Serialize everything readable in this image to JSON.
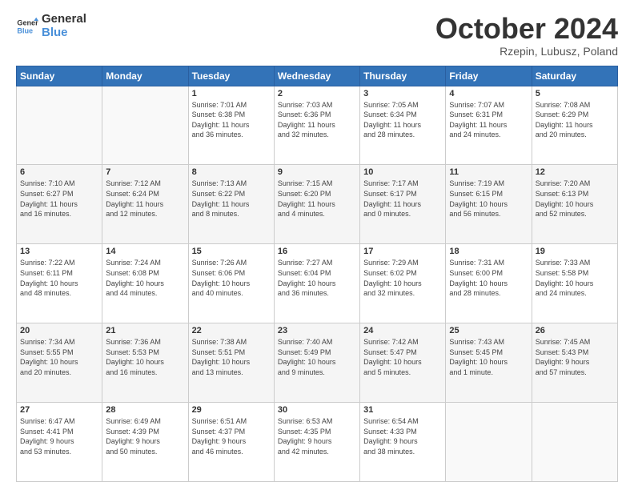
{
  "logo": {
    "line1": "General",
    "line2": "Blue"
  },
  "title": "October 2024",
  "location": "Rzepin, Lubusz, Poland",
  "header_days": [
    "Sunday",
    "Monday",
    "Tuesday",
    "Wednesday",
    "Thursday",
    "Friday",
    "Saturday"
  ],
  "weeks": [
    [
      {
        "day": "",
        "info": ""
      },
      {
        "day": "",
        "info": ""
      },
      {
        "day": "1",
        "info": "Sunrise: 7:01 AM\nSunset: 6:38 PM\nDaylight: 11 hours\nand 36 minutes."
      },
      {
        "day": "2",
        "info": "Sunrise: 7:03 AM\nSunset: 6:36 PM\nDaylight: 11 hours\nand 32 minutes."
      },
      {
        "day": "3",
        "info": "Sunrise: 7:05 AM\nSunset: 6:34 PM\nDaylight: 11 hours\nand 28 minutes."
      },
      {
        "day": "4",
        "info": "Sunrise: 7:07 AM\nSunset: 6:31 PM\nDaylight: 11 hours\nand 24 minutes."
      },
      {
        "day": "5",
        "info": "Sunrise: 7:08 AM\nSunset: 6:29 PM\nDaylight: 11 hours\nand 20 minutes."
      }
    ],
    [
      {
        "day": "6",
        "info": "Sunrise: 7:10 AM\nSunset: 6:27 PM\nDaylight: 11 hours\nand 16 minutes."
      },
      {
        "day": "7",
        "info": "Sunrise: 7:12 AM\nSunset: 6:24 PM\nDaylight: 11 hours\nand 12 minutes."
      },
      {
        "day": "8",
        "info": "Sunrise: 7:13 AM\nSunset: 6:22 PM\nDaylight: 11 hours\nand 8 minutes."
      },
      {
        "day": "9",
        "info": "Sunrise: 7:15 AM\nSunset: 6:20 PM\nDaylight: 11 hours\nand 4 minutes."
      },
      {
        "day": "10",
        "info": "Sunrise: 7:17 AM\nSunset: 6:17 PM\nDaylight: 11 hours\nand 0 minutes."
      },
      {
        "day": "11",
        "info": "Sunrise: 7:19 AM\nSunset: 6:15 PM\nDaylight: 10 hours\nand 56 minutes."
      },
      {
        "day": "12",
        "info": "Sunrise: 7:20 AM\nSunset: 6:13 PM\nDaylight: 10 hours\nand 52 minutes."
      }
    ],
    [
      {
        "day": "13",
        "info": "Sunrise: 7:22 AM\nSunset: 6:11 PM\nDaylight: 10 hours\nand 48 minutes."
      },
      {
        "day": "14",
        "info": "Sunrise: 7:24 AM\nSunset: 6:08 PM\nDaylight: 10 hours\nand 44 minutes."
      },
      {
        "day": "15",
        "info": "Sunrise: 7:26 AM\nSunset: 6:06 PM\nDaylight: 10 hours\nand 40 minutes."
      },
      {
        "day": "16",
        "info": "Sunrise: 7:27 AM\nSunset: 6:04 PM\nDaylight: 10 hours\nand 36 minutes."
      },
      {
        "day": "17",
        "info": "Sunrise: 7:29 AM\nSunset: 6:02 PM\nDaylight: 10 hours\nand 32 minutes."
      },
      {
        "day": "18",
        "info": "Sunrise: 7:31 AM\nSunset: 6:00 PM\nDaylight: 10 hours\nand 28 minutes."
      },
      {
        "day": "19",
        "info": "Sunrise: 7:33 AM\nSunset: 5:58 PM\nDaylight: 10 hours\nand 24 minutes."
      }
    ],
    [
      {
        "day": "20",
        "info": "Sunrise: 7:34 AM\nSunset: 5:55 PM\nDaylight: 10 hours\nand 20 minutes."
      },
      {
        "day": "21",
        "info": "Sunrise: 7:36 AM\nSunset: 5:53 PM\nDaylight: 10 hours\nand 16 minutes."
      },
      {
        "day": "22",
        "info": "Sunrise: 7:38 AM\nSunset: 5:51 PM\nDaylight: 10 hours\nand 13 minutes."
      },
      {
        "day": "23",
        "info": "Sunrise: 7:40 AM\nSunset: 5:49 PM\nDaylight: 10 hours\nand 9 minutes."
      },
      {
        "day": "24",
        "info": "Sunrise: 7:42 AM\nSunset: 5:47 PM\nDaylight: 10 hours\nand 5 minutes."
      },
      {
        "day": "25",
        "info": "Sunrise: 7:43 AM\nSunset: 5:45 PM\nDaylight: 10 hours\nand 1 minute."
      },
      {
        "day": "26",
        "info": "Sunrise: 7:45 AM\nSunset: 5:43 PM\nDaylight: 9 hours\nand 57 minutes."
      }
    ],
    [
      {
        "day": "27",
        "info": "Sunrise: 6:47 AM\nSunset: 4:41 PM\nDaylight: 9 hours\nand 53 minutes."
      },
      {
        "day": "28",
        "info": "Sunrise: 6:49 AM\nSunset: 4:39 PM\nDaylight: 9 hours\nand 50 minutes."
      },
      {
        "day": "29",
        "info": "Sunrise: 6:51 AM\nSunset: 4:37 PM\nDaylight: 9 hours\nand 46 minutes."
      },
      {
        "day": "30",
        "info": "Sunrise: 6:53 AM\nSunset: 4:35 PM\nDaylight: 9 hours\nand 42 minutes."
      },
      {
        "day": "31",
        "info": "Sunrise: 6:54 AM\nSunset: 4:33 PM\nDaylight: 9 hours\nand 38 minutes."
      },
      {
        "day": "",
        "info": ""
      },
      {
        "day": "",
        "info": ""
      }
    ]
  ]
}
